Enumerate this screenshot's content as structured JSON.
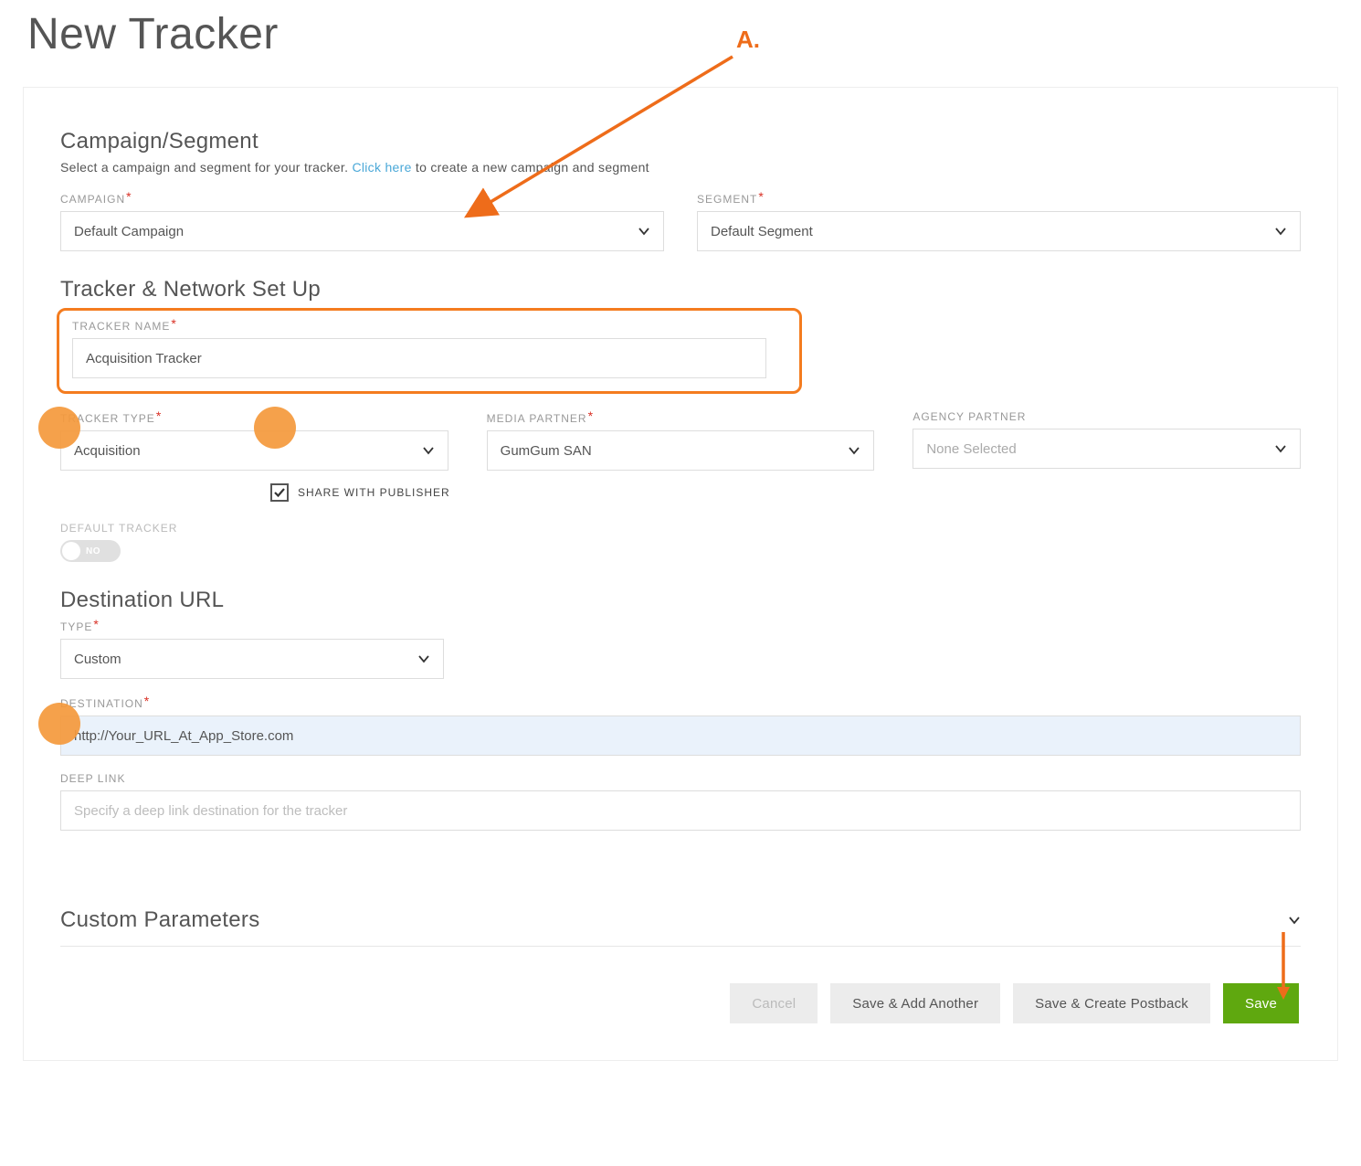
{
  "page": {
    "title": "New Tracker"
  },
  "annotations": {
    "a_label": "A."
  },
  "campaign_section": {
    "title": "Campaign/Segment",
    "help_pre": "Select a campaign and segment for your tracker. ",
    "help_link": "Click here",
    "help_post": " to create a new campaign and segment",
    "campaign_label": "CAMPAIGN",
    "campaign_value": "Default Campaign",
    "segment_label": "SEGMENT",
    "segment_value": "Default Segment"
  },
  "tracker_section": {
    "title": "Tracker & Network Set Up",
    "name_label": "TRACKER NAME",
    "name_value": "Acquisition Tracker",
    "type_label": "TRACKER TYPE",
    "type_value": "Acquisition",
    "media_label": "MEDIA PARTNER",
    "media_value": "GumGum SAN",
    "agency_label": "AGENCY PARTNER",
    "agency_value": "None Selected",
    "share_label": "SHARE WITH PUBLISHER",
    "share_checked": true,
    "default_label": "DEFAULT TRACKER",
    "default_toggle_text": "NO"
  },
  "destination_section": {
    "title": "Destination URL",
    "type_label": "TYPE",
    "type_value": "Custom",
    "dest_label": "DESTINATION",
    "dest_value": "http://Your_URL_At_App_Store.com",
    "deep_label": "DEEP LINK",
    "deep_placeholder": "Specify a deep link destination for the tracker"
  },
  "custom_params": {
    "title": "Custom Parameters"
  },
  "actions": {
    "cancel": "Cancel",
    "save_add": "Save & Add Another",
    "save_postback": "Save & Create Postback",
    "save": "Save"
  }
}
